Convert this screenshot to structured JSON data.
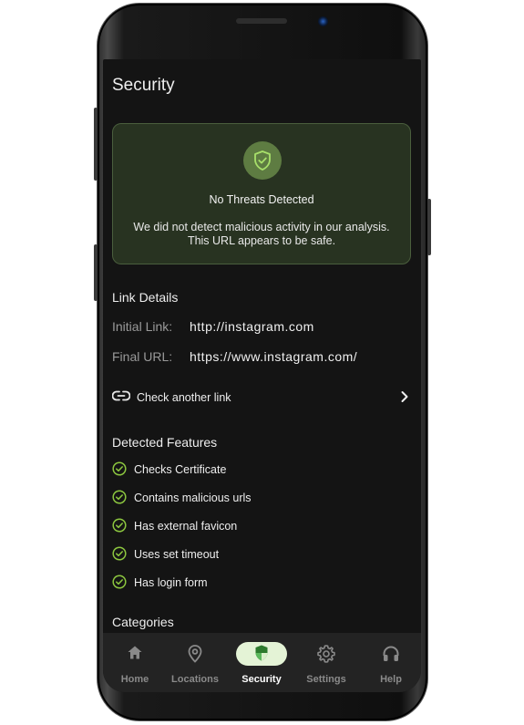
{
  "screen": {
    "title": "Security"
  },
  "banner": {
    "icon": "shield-check-icon",
    "title": "No Threats Detected",
    "message": "We did not detect malicious activity in our analysis. This URL appears to be safe."
  },
  "link_details": {
    "heading": "Link Details",
    "initial_label": "Initial Link:",
    "initial_value": "http://instagram.com",
    "final_label": "Final URL:",
    "final_value": "https://www.instagram.com/"
  },
  "check_link": {
    "label": "Check another link"
  },
  "detected": {
    "heading": "Detected Features",
    "items": [
      {
        "label": "Checks Certificate"
      },
      {
        "label": "Contains malicious urls"
      },
      {
        "label": "Has external favicon"
      },
      {
        "label": "Uses set timeout"
      },
      {
        "label": "Has login form"
      }
    ]
  },
  "categories": {
    "heading": "Categories"
  },
  "nav": {
    "items": [
      {
        "label": "Home",
        "icon": "home-icon"
      },
      {
        "label": "Locations",
        "icon": "location-pin-icon"
      },
      {
        "label": "Security",
        "icon": "shield-icon",
        "active": true
      },
      {
        "label": "Settings",
        "icon": "gear-icon"
      },
      {
        "label": "Help",
        "icon": "headset-icon"
      }
    ]
  },
  "colors": {
    "accent_green": "#8cc63f",
    "banner_bg": "#283321",
    "screen_bg": "#141414",
    "nav_pill": "#e4f3d6"
  }
}
